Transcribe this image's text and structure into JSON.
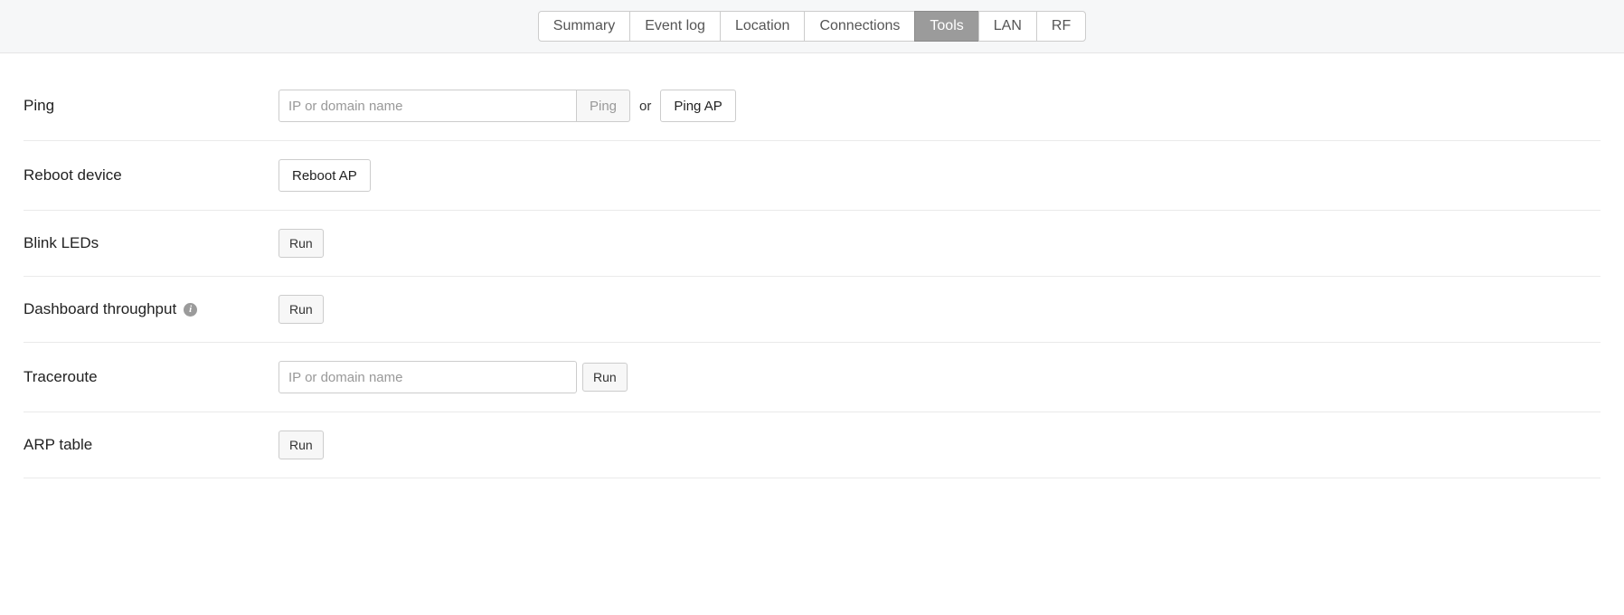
{
  "tabs": {
    "summary": "Summary",
    "event_log": "Event log",
    "location": "Location",
    "connections": "Connections",
    "tools": "Tools",
    "lan": "LAN",
    "rf": "RF"
  },
  "rows": {
    "ping": {
      "label": "Ping",
      "placeholder": "IP or domain name",
      "ping_btn": "Ping",
      "or": "or",
      "ping_ap_btn": "Ping AP"
    },
    "reboot": {
      "label": "Reboot device",
      "btn": "Reboot AP"
    },
    "blink": {
      "label": "Blink LEDs",
      "btn": "Run"
    },
    "throughput": {
      "label": "Dashboard throughput",
      "btn": "Run"
    },
    "traceroute": {
      "label": "Traceroute",
      "placeholder": "IP or domain name",
      "btn": "Run"
    },
    "arp": {
      "label": "ARP table",
      "btn": "Run"
    }
  }
}
